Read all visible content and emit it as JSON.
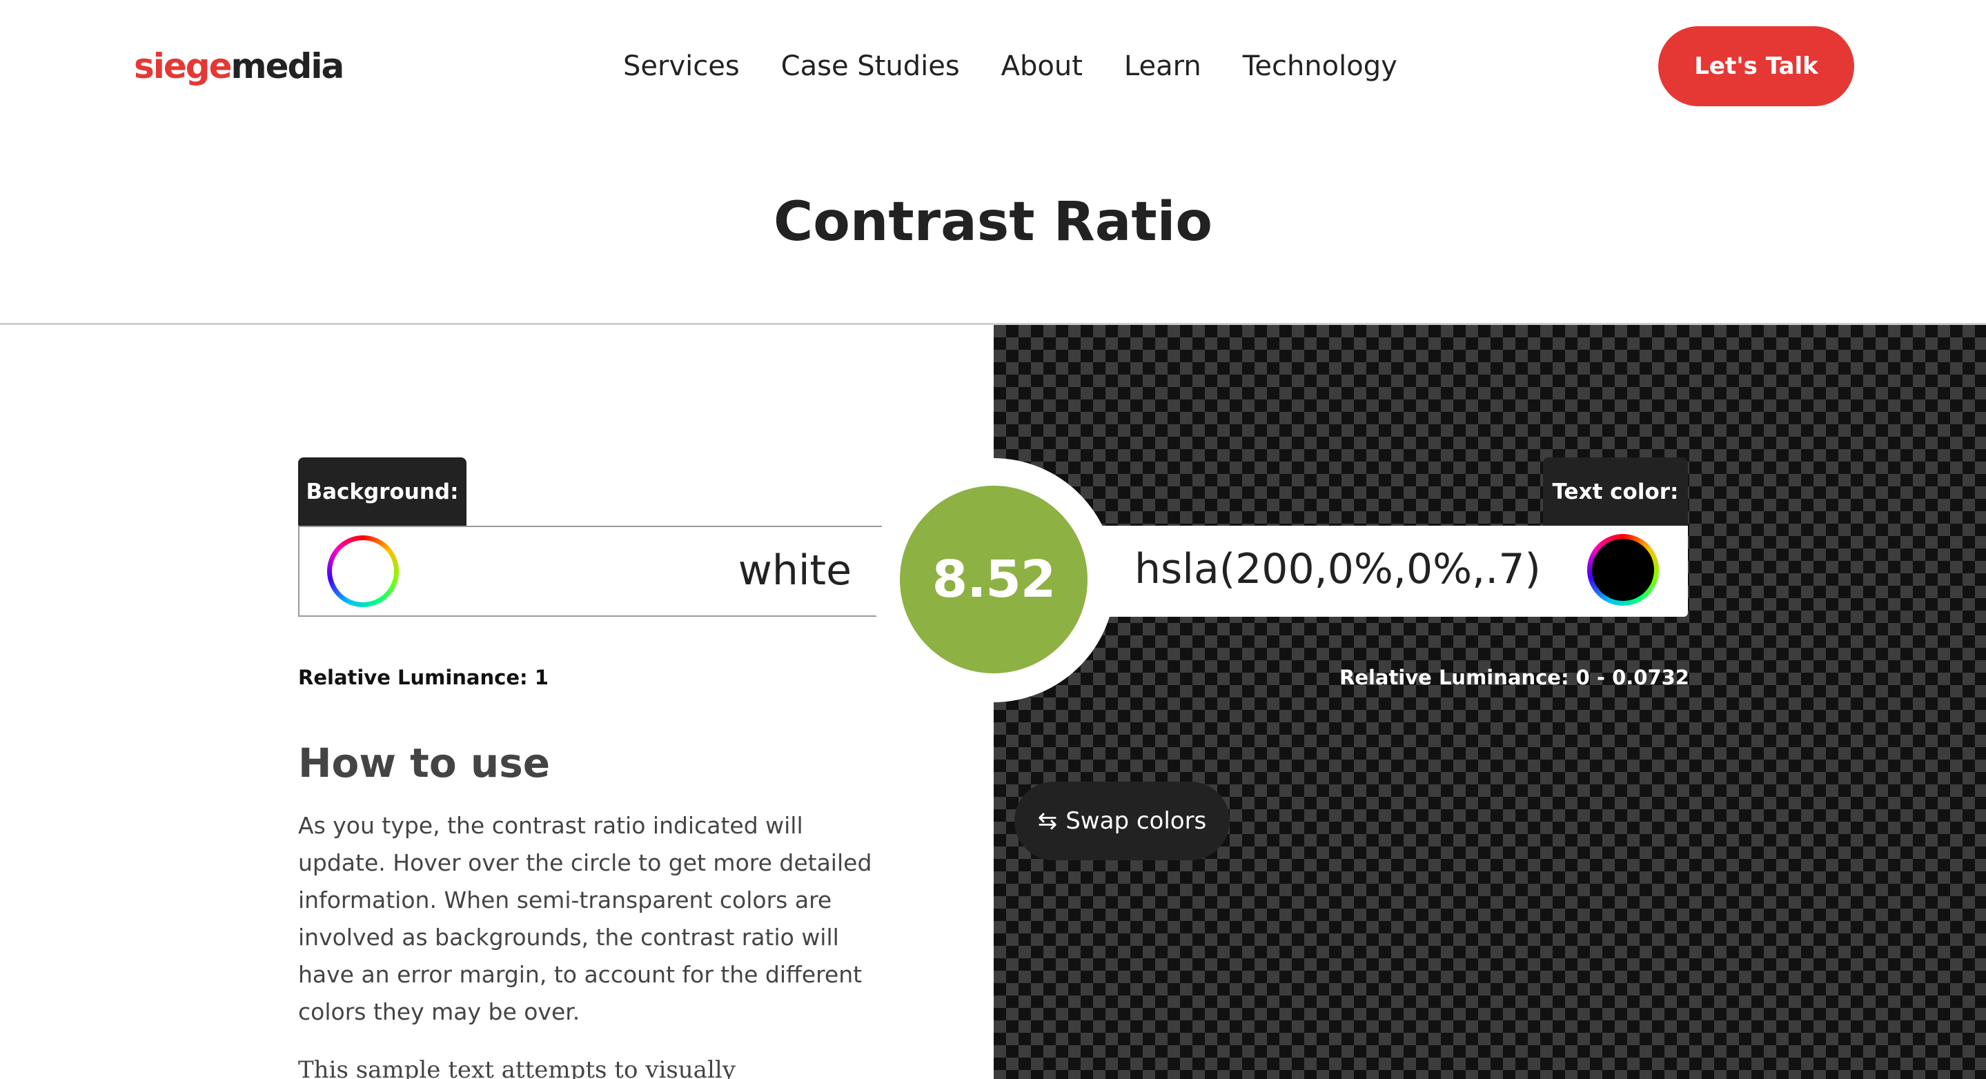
{
  "header": {
    "logo": {
      "part1": "siege",
      "part2": "media"
    },
    "nav": [
      "Services",
      "Case Studies",
      "About",
      "Learn",
      "Technology"
    ],
    "cta": "Let's Talk"
  },
  "page_title": "Contrast Ratio",
  "background": {
    "label": "Background:",
    "value": "white",
    "luminance_label": "Relative Luminance:",
    "luminance_value": "1"
  },
  "text_color": {
    "label": "Text color:",
    "value": "hsla(200,0%,0%,.7)",
    "luminance_label": "Relative Luminance:",
    "luminance_value": "0 - 0.0732"
  },
  "ratio": "8.52",
  "swap": {
    "icon": "swap-arrows-icon",
    "label": "Swap colors"
  },
  "how_to_use": {
    "title": "How to use",
    "text": "As you type, the contrast ratio indicated will update. Hover over the circle to get more detailed information. When semi-transparent colors are involved as backgrounds, the contrast ratio will have an error margin, to account for the different colors they may be over."
  },
  "sample_text": "This sample text attempts to visually",
  "colors": {
    "brand_red": "#e53835",
    "ratio_green": "#8db143",
    "dark": "#222222"
  }
}
